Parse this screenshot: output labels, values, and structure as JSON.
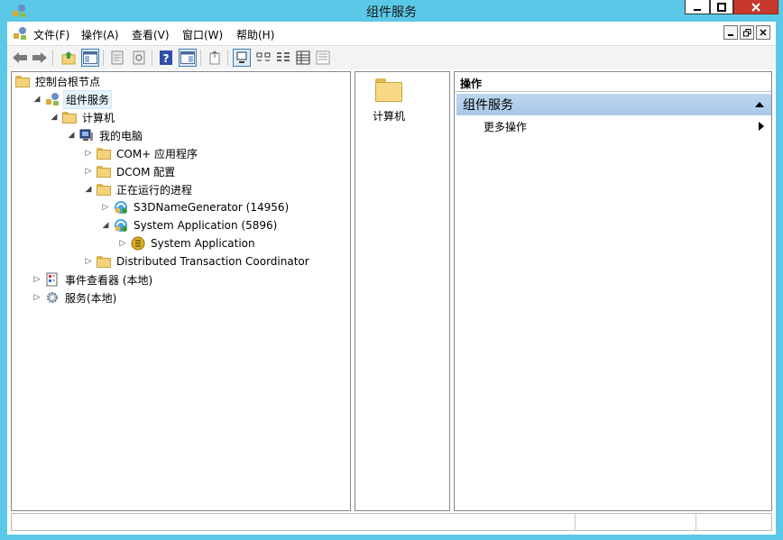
{
  "window": {
    "title": "组件服务"
  },
  "menu": {
    "items": [
      "文件(F)",
      "操作(A)",
      "查看(V)",
      "窗口(W)",
      "帮助(H)"
    ]
  },
  "toolbar": {
    "icons": [
      "back-icon",
      "forward-icon",
      "up-folder-icon",
      "show-tree-icon",
      "properties-icon",
      "refresh-icon",
      "help-icon",
      "show-action-pane-icon",
      "export-list-icon",
      "large-icons-view-icon",
      "small-icons-view-icon",
      "list-view-icon",
      "details-view-icon",
      "status-view-icon"
    ]
  },
  "tree": {
    "items": [
      {
        "label": "控制台根节点",
        "depth": 0,
        "expander": "none",
        "icon": "folder-icon"
      },
      {
        "label": "组件服务",
        "depth": 1,
        "expander": "expanded",
        "icon": "component-services-icon",
        "selected": true
      },
      {
        "label": "计算机",
        "depth": 2,
        "expander": "expanded",
        "icon": "folder-icon"
      },
      {
        "label": "我的电脑",
        "depth": 3,
        "expander": "expanded",
        "icon": "computer-icon"
      },
      {
        "label": "COM+ 应用程序",
        "depth": 4,
        "expander": "collapsed",
        "icon": "folder-icon"
      },
      {
        "label": "DCOM 配置",
        "depth": 4,
        "expander": "collapsed",
        "icon": "folder-icon"
      },
      {
        "label": "正在运行的进程",
        "depth": 4,
        "expander": "expanded",
        "icon": "folder-icon"
      },
      {
        "label": "S3DNameGenerator (14956)",
        "depth": 5,
        "expander": "collapsed",
        "icon": "process-icon"
      },
      {
        "label": "System Application (5896)",
        "depth": 5,
        "expander": "expanded",
        "icon": "process-icon"
      },
      {
        "label": "System Application",
        "depth": 6,
        "expander": "collapsed",
        "icon": "com-object-icon"
      },
      {
        "label": "Distributed Transaction Coordinator",
        "depth": 4,
        "expander": "collapsed",
        "icon": "folder-icon"
      },
      {
        "label": "事件查看器 (本地)",
        "depth": 1,
        "expander": "collapsed",
        "icon": "event-viewer-icon"
      },
      {
        "label": "服务(本地)",
        "depth": 1,
        "expander": "collapsed",
        "icon": "services-gear-icon"
      }
    ]
  },
  "list": {
    "items": [
      {
        "label": "计算机",
        "icon": "folder-icon"
      }
    ]
  },
  "actions": {
    "header": "操作",
    "section_title": "组件服务",
    "items": [
      {
        "label": "更多操作"
      }
    ]
  },
  "colors": {
    "titlebar": "#5ac8e6",
    "close_button": "#c7392d",
    "selection": "#e5f3fb",
    "action_section": "#bcd6ee"
  }
}
